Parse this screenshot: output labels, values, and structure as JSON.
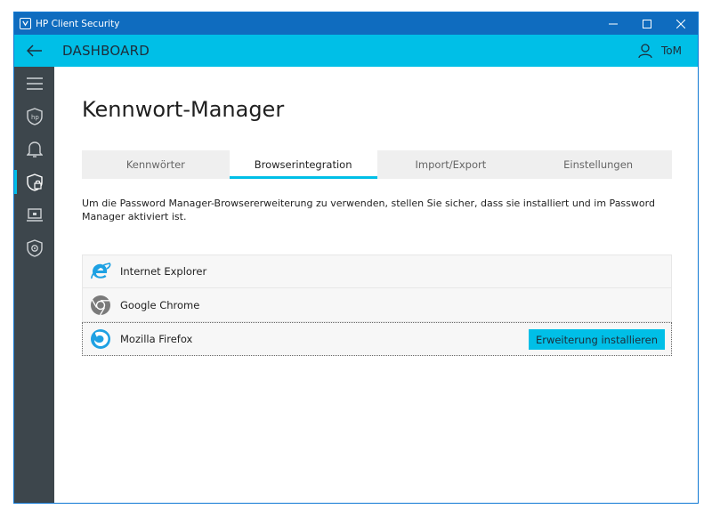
{
  "window": {
    "title": "HP Client Security"
  },
  "header": {
    "title": "DASHBOARD",
    "user": "ToM"
  },
  "sidebar": {
    "items": [
      {
        "icon": "menu-icon"
      },
      {
        "icon": "hp-shield-icon"
      },
      {
        "icon": "bell-icon"
      },
      {
        "icon": "lock-shield-icon",
        "active": true
      },
      {
        "icon": "laptop-icon"
      },
      {
        "icon": "gear-shield-icon"
      }
    ]
  },
  "main": {
    "title": "Kennwort-Manager",
    "tabs": [
      {
        "label": "Kennwörter"
      },
      {
        "label": "Browserintegration",
        "active": true
      },
      {
        "label": "Import/Export"
      },
      {
        "label": "Einstellungen"
      }
    ],
    "description": "Um die Password Manager-Browsererweiterung zu verwenden, stellen Sie sicher, dass sie installiert und im Password Manager aktiviert ist.",
    "browsers": [
      {
        "name": "Internet Explorer",
        "icon": "internet-explorer-icon"
      },
      {
        "name": "Google Chrome",
        "icon": "chrome-icon"
      },
      {
        "name": "Mozilla Firefox",
        "icon": "firefox-icon",
        "button": "Erweiterung installieren"
      }
    ]
  },
  "colors": {
    "accent": "#00bfe7",
    "titlebar": "#0f6cbf",
    "sidebar": "#3d464c"
  }
}
